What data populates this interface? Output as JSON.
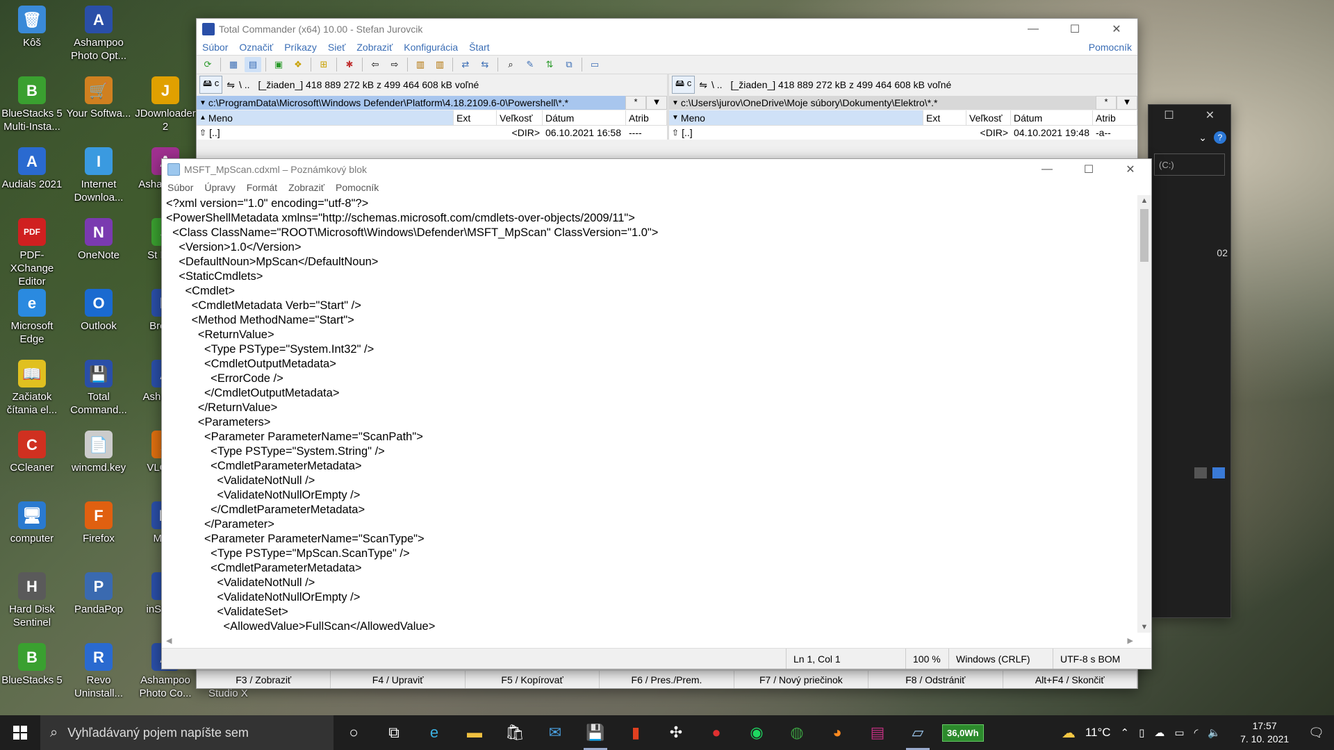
{
  "desktop": {
    "icons": [
      {
        "label": "Kôš",
        "glyph": "🗑"
      },
      {
        "label": "Ashampoo Photo Opt...",
        "glyph": "A"
      },
      {
        "label": "BlueStacks 5 Multi-Insta...",
        "glyph": "B"
      },
      {
        "label": "Your Softwa...",
        "glyph": "🛒"
      },
      {
        "label": "JDownloader 2",
        "glyph": "J"
      },
      {
        "label": "Audials 2021",
        "glyph": "A"
      },
      {
        "label": "Internet Downloa...",
        "glyph": "I"
      },
      {
        "label": "Asha Music",
        "glyph": "A"
      },
      {
        "label": "PDF-XChange Editor",
        "glyph": "PDF"
      },
      {
        "label": "OneNote",
        "glyph": "N"
      },
      {
        "label": "St Pass",
        "glyph": "S"
      },
      {
        "label": "Microsoft Edge",
        "glyph": "e"
      },
      {
        "label": "Outlook",
        "glyph": "O"
      },
      {
        "label": "Bro Uti",
        "glyph": "B"
      },
      {
        "label": "Začiatok čítania el...",
        "glyph": "📖"
      },
      {
        "label": "Total Command...",
        "glyph": "💾"
      },
      {
        "label": "Asha Sna",
        "glyph": "A"
      },
      {
        "label": "CCleaner",
        "glyph": "C"
      },
      {
        "label": "wincmd.key",
        "glyph": "📄"
      },
      {
        "label": "VLC pla",
        "glyph": "▲"
      },
      {
        "label": "computer",
        "glyph": "🖥"
      },
      {
        "label": "Firefox",
        "glyph": "F"
      },
      {
        "label": "Malw",
        "glyph": "M"
      },
      {
        "label": "Hard Disk Sentinel",
        "glyph": "H"
      },
      {
        "label": "PandaPop",
        "glyph": "P"
      },
      {
        "label": "inSS Ho",
        "glyph": "i"
      },
      {
        "label": "BlueStacks 5",
        "glyph": "B"
      },
      {
        "label": "Revo Uninstall...",
        "glyph": "R"
      },
      {
        "label": "Ashampoo Photo Co...",
        "glyph": "A"
      }
    ],
    "studio_label": "Studio X"
  },
  "tc": {
    "title": "Total Commander (x64) 10.00 - Stefan Jurovcik",
    "menu": [
      "Súbor",
      "Označiť",
      "Príkazy",
      "Sieť",
      "Zobraziť",
      "Konfigurácia",
      "Štart"
    ],
    "menu_help": "Pomocník",
    "left": {
      "drive": "c",
      "root": "\\  ..",
      "free": "[_žiaden_]  418 889 272 kB z 499 464 608 kB voľné",
      "path": "c:\\ProgramData\\Microsoft\\Windows Defender\\Platform\\4.18.2109.6-0\\Powershell\\*.*",
      "filter": "*",
      "cols": [
        "Meno",
        "Ext",
        "Veľkosť",
        "Dátum",
        "Atrib"
      ],
      "row": {
        "name": "[..]",
        "ext": "",
        "size": "<DIR>",
        "date": "06.10.2021 16:58",
        "attr": "----"
      }
    },
    "right": {
      "drive": "c",
      "root": "\\  ..",
      "free": "[_žiaden_]  418 889 272 kB z 499 464 608 kB voľné",
      "path": "c:\\Users\\jurov\\OneDrive\\Moje súbory\\Dokumenty\\Elektro\\*.*",
      "filter": "*",
      "cols": [
        "Meno",
        "Ext",
        "Veľkosť",
        "Dátum",
        "Atrib"
      ],
      "row": {
        "name": "[..]",
        "ext": "",
        "size": "<DIR>",
        "date": "04.10.2021 19:48",
        "attr": "-a--"
      }
    },
    "fnkeys": [
      "F3 / Zobraziť",
      "F4 / Upraviť",
      "F5 / Kopírovať",
      "F6 / Pres./Prem.",
      "F7 / Nový priečinok",
      "F8 / Odstrániť",
      "Alt+F4 / Skončiť"
    ]
  },
  "notepad": {
    "title": "MSFT_MpScan.cdxml – Poznámkový blok",
    "menu": [
      "Súbor",
      "Úpravy",
      "Formát",
      "Zobraziť",
      "Pomocník"
    ],
    "lines": [
      "<?xml version=\"1.0\" encoding=\"utf-8\"?>",
      "<PowerShellMetadata xmlns=\"http://schemas.microsoft.com/cmdlets-over-objects/2009/11\">",
      "  <Class ClassName=\"ROOT\\Microsoft\\Windows\\Defender\\MSFT_MpScan\" ClassVersion=\"1.0\">",
      "    <Version>1.0</Version>",
      "    <DefaultNoun>MpScan</DefaultNoun>",
      "    <StaticCmdlets>",
      "      <Cmdlet>",
      "        <CmdletMetadata Verb=\"Start\" />",
      "        <Method MethodName=\"Start\">",
      "          <ReturnValue>",
      "            <Type PSType=\"System.Int32\" />",
      "            <CmdletOutputMetadata>",
      "              <ErrorCode />",
      "            </CmdletOutputMetadata>",
      "          </ReturnValue>",
      "          <Parameters>",
      "            <Parameter ParameterName=\"ScanPath\">",
      "              <Type PSType=\"System.String\" />",
      "              <CmdletParameterMetadata>",
      "                <ValidateNotNull />",
      "                <ValidateNotNullOrEmpty />",
      "              </CmdletParameterMetadata>",
      "            </Parameter>",
      "            <Parameter ParameterName=\"ScanType\">",
      "              <Type PSType=\"MpScan.ScanType\" />",
      "              <CmdletParameterMetadata>",
      "                <ValidateNotNull />",
      "                <ValidateNotNullOrEmpty />",
      "                <ValidateSet>",
      "                  <AllowedValue>FullScan</AllowedValue>"
    ],
    "status": {
      "pos": "Ln 1, Col 1",
      "zoom": "100 %",
      "eol": "Windows (CRLF)",
      "enc": "UTF-8 s BOM"
    }
  },
  "bgwin": {
    "drive_hint": "(C:)",
    "side_text": "02"
  },
  "taskbar": {
    "search_placeholder": "Vyhľadávaný pojem napíšte sem",
    "battery": "36,0Wh",
    "weather": "11°C",
    "time": "17:57",
    "date": "7. 10. 2021"
  }
}
